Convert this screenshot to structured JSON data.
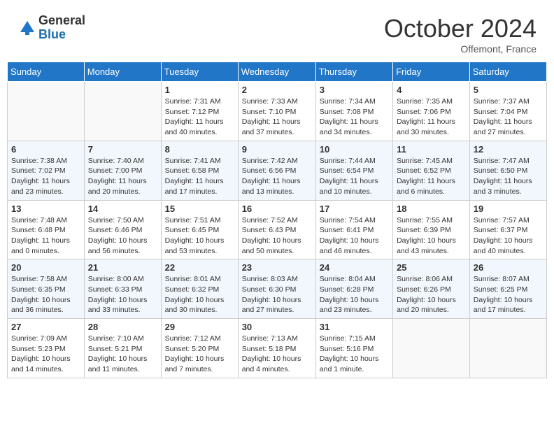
{
  "header": {
    "logo_general": "General",
    "logo_blue": "Blue",
    "month_title": "October 2024",
    "subtitle": "Offemont, France"
  },
  "days_of_week": [
    "Sunday",
    "Monday",
    "Tuesday",
    "Wednesday",
    "Thursday",
    "Friday",
    "Saturday"
  ],
  "weeks": [
    [
      {
        "day": "",
        "info": ""
      },
      {
        "day": "",
        "info": ""
      },
      {
        "day": "1",
        "info": "Sunrise: 7:31 AM\nSunset: 7:12 PM\nDaylight: 11 hours and 40 minutes."
      },
      {
        "day": "2",
        "info": "Sunrise: 7:33 AM\nSunset: 7:10 PM\nDaylight: 11 hours and 37 minutes."
      },
      {
        "day": "3",
        "info": "Sunrise: 7:34 AM\nSunset: 7:08 PM\nDaylight: 11 hours and 34 minutes."
      },
      {
        "day": "4",
        "info": "Sunrise: 7:35 AM\nSunset: 7:06 PM\nDaylight: 11 hours and 30 minutes."
      },
      {
        "day": "5",
        "info": "Sunrise: 7:37 AM\nSunset: 7:04 PM\nDaylight: 11 hours and 27 minutes."
      }
    ],
    [
      {
        "day": "6",
        "info": "Sunrise: 7:38 AM\nSunset: 7:02 PM\nDaylight: 11 hours and 23 minutes."
      },
      {
        "day": "7",
        "info": "Sunrise: 7:40 AM\nSunset: 7:00 PM\nDaylight: 11 hours and 20 minutes."
      },
      {
        "day": "8",
        "info": "Sunrise: 7:41 AM\nSunset: 6:58 PM\nDaylight: 11 hours and 17 minutes."
      },
      {
        "day": "9",
        "info": "Sunrise: 7:42 AM\nSunset: 6:56 PM\nDaylight: 11 hours and 13 minutes."
      },
      {
        "day": "10",
        "info": "Sunrise: 7:44 AM\nSunset: 6:54 PM\nDaylight: 11 hours and 10 minutes."
      },
      {
        "day": "11",
        "info": "Sunrise: 7:45 AM\nSunset: 6:52 PM\nDaylight: 11 hours and 6 minutes."
      },
      {
        "day": "12",
        "info": "Sunrise: 7:47 AM\nSunset: 6:50 PM\nDaylight: 11 hours and 3 minutes."
      }
    ],
    [
      {
        "day": "13",
        "info": "Sunrise: 7:48 AM\nSunset: 6:48 PM\nDaylight: 11 hours and 0 minutes."
      },
      {
        "day": "14",
        "info": "Sunrise: 7:50 AM\nSunset: 6:46 PM\nDaylight: 10 hours and 56 minutes."
      },
      {
        "day": "15",
        "info": "Sunrise: 7:51 AM\nSunset: 6:45 PM\nDaylight: 10 hours and 53 minutes."
      },
      {
        "day": "16",
        "info": "Sunrise: 7:52 AM\nSunset: 6:43 PM\nDaylight: 10 hours and 50 minutes."
      },
      {
        "day": "17",
        "info": "Sunrise: 7:54 AM\nSunset: 6:41 PM\nDaylight: 10 hours and 46 minutes."
      },
      {
        "day": "18",
        "info": "Sunrise: 7:55 AM\nSunset: 6:39 PM\nDaylight: 10 hours and 43 minutes."
      },
      {
        "day": "19",
        "info": "Sunrise: 7:57 AM\nSunset: 6:37 PM\nDaylight: 10 hours and 40 minutes."
      }
    ],
    [
      {
        "day": "20",
        "info": "Sunrise: 7:58 AM\nSunset: 6:35 PM\nDaylight: 10 hours and 36 minutes."
      },
      {
        "day": "21",
        "info": "Sunrise: 8:00 AM\nSunset: 6:33 PM\nDaylight: 10 hours and 33 minutes."
      },
      {
        "day": "22",
        "info": "Sunrise: 8:01 AM\nSunset: 6:32 PM\nDaylight: 10 hours and 30 minutes."
      },
      {
        "day": "23",
        "info": "Sunrise: 8:03 AM\nSunset: 6:30 PM\nDaylight: 10 hours and 27 minutes."
      },
      {
        "day": "24",
        "info": "Sunrise: 8:04 AM\nSunset: 6:28 PM\nDaylight: 10 hours and 23 minutes."
      },
      {
        "day": "25",
        "info": "Sunrise: 8:06 AM\nSunset: 6:26 PM\nDaylight: 10 hours and 20 minutes."
      },
      {
        "day": "26",
        "info": "Sunrise: 8:07 AM\nSunset: 6:25 PM\nDaylight: 10 hours and 17 minutes."
      }
    ],
    [
      {
        "day": "27",
        "info": "Sunrise: 7:09 AM\nSunset: 5:23 PM\nDaylight: 10 hours and 14 minutes."
      },
      {
        "day": "28",
        "info": "Sunrise: 7:10 AM\nSunset: 5:21 PM\nDaylight: 10 hours and 11 minutes."
      },
      {
        "day": "29",
        "info": "Sunrise: 7:12 AM\nSunset: 5:20 PM\nDaylight: 10 hours and 7 minutes."
      },
      {
        "day": "30",
        "info": "Sunrise: 7:13 AM\nSunset: 5:18 PM\nDaylight: 10 hours and 4 minutes."
      },
      {
        "day": "31",
        "info": "Sunrise: 7:15 AM\nSunset: 5:16 PM\nDaylight: 10 hours and 1 minute."
      },
      {
        "day": "",
        "info": ""
      },
      {
        "day": "",
        "info": ""
      }
    ]
  ]
}
